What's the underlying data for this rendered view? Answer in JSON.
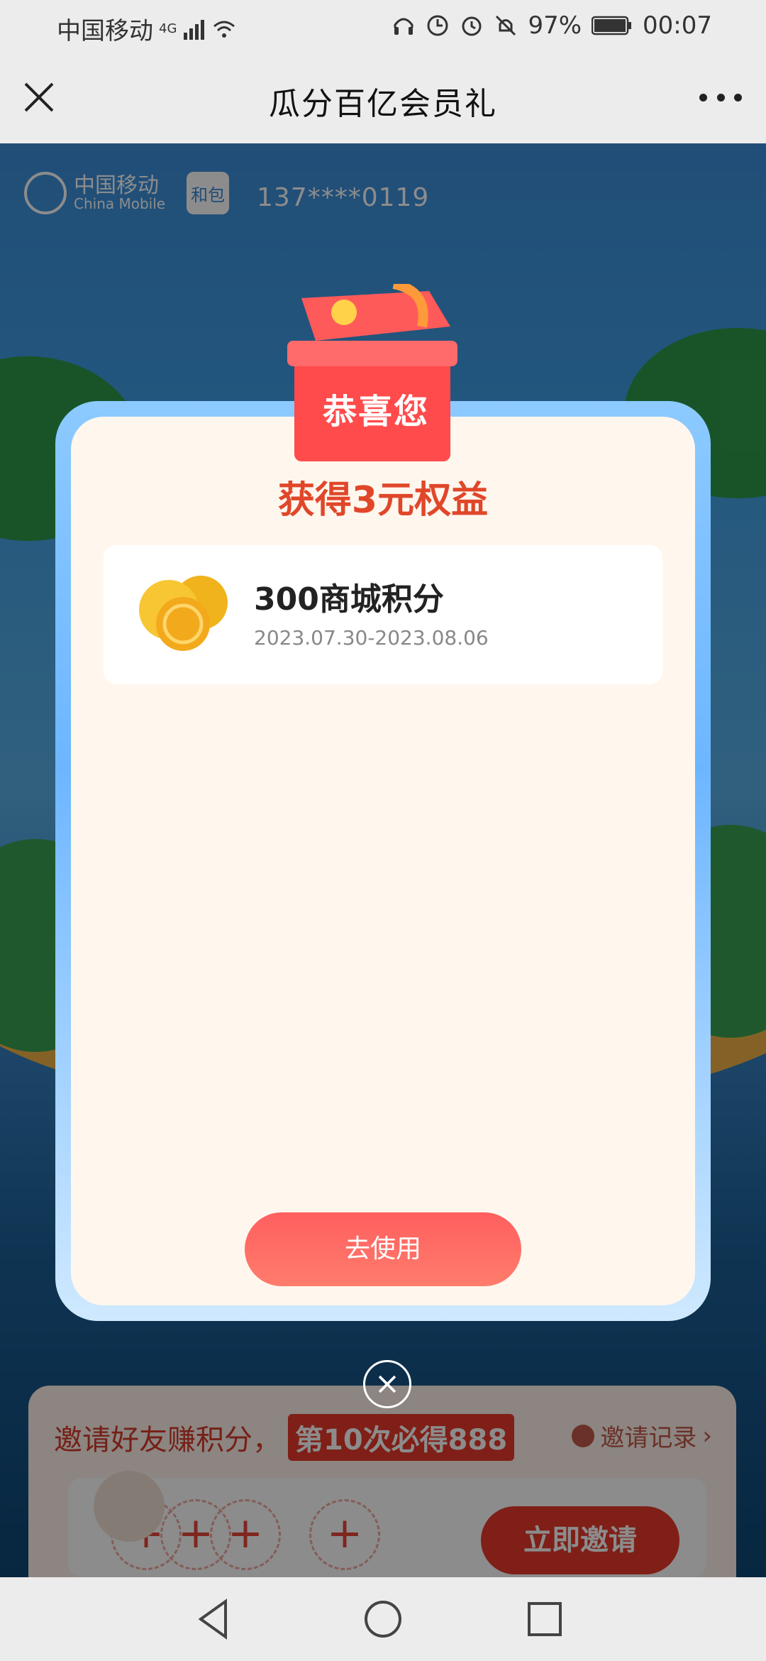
{
  "status_bar": {
    "carrier": "中国移动",
    "network": "4G",
    "battery": "97%",
    "time": "00:07"
  },
  "header": {
    "title": "瓜分百亿会员礼"
  },
  "background": {
    "logo_cn": "中国移动",
    "logo_en": "China Mobile",
    "hebao": "和包",
    "phone": "137****0119",
    "invite_title": "邀请好友赚积分，",
    "invite_badge": "第10次必得888",
    "invite_record": "邀请记录",
    "invite_button": "立即邀请",
    "slot_plus": "+"
  },
  "modal": {
    "banner": "恭喜您",
    "title": "获得3元权益",
    "reward": {
      "name": "300商城积分",
      "validity": "2023.07.30-2023.08.06"
    },
    "use_button": "去使用"
  }
}
